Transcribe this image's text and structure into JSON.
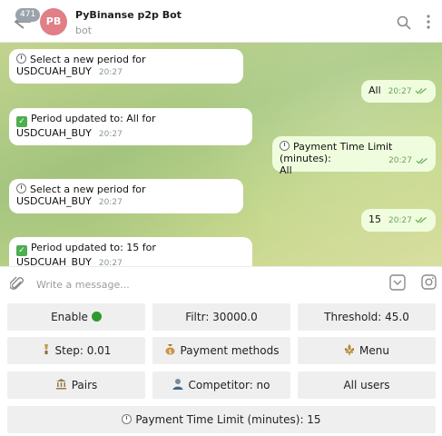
{
  "header": {
    "unread_count": "471",
    "avatar_initials": "PB",
    "title": "PyBinanse p2p Bot",
    "subtitle": "bot",
    "avatar_color": "#e07f86"
  },
  "messages": [
    {
      "dir": "in",
      "emoji": "clock",
      "text": "Select a new period for USDCUAH_BUY",
      "time": "20:27"
    },
    {
      "dir": "out",
      "text": "All",
      "time": "20:27"
    },
    {
      "dir": "in",
      "emoji": "check",
      "text": "Period updated to: All for USDCUAH_BUY",
      "time": "20:27"
    },
    {
      "dir": "out",
      "emoji": "clock",
      "text": "Payment Time Limit (minutes):",
      "text2": "All",
      "time": "20:27"
    },
    {
      "dir": "in",
      "emoji": "clock",
      "text": "Select a new period for USDCUAH_BUY",
      "time": "20:27"
    },
    {
      "dir": "out",
      "text": "15",
      "time": "20:27"
    },
    {
      "dir": "in",
      "emoji": "check",
      "text": "Period updated to: 15 for USDCUAH_BUY",
      "time": "20:27"
    }
  ],
  "composer": {
    "placeholder": "Write a message..."
  },
  "keyboard": {
    "enable": "Enable",
    "filtr": "Filtr: 30000.0",
    "threshold": "Threshold: 45.0",
    "step": "Step: 0.01",
    "payment_methods": "Payment methods",
    "menu": "Menu",
    "pairs": "Pairs",
    "competitor": "Competitor: no",
    "all_users": "All users",
    "payment_time_limit": "Payment Time Limit (minutes): 15"
  },
  "colors": {
    "incoming_bubble": "#ffffff",
    "outgoing_bubble": "#effdde",
    "key_bg": "#efefef"
  }
}
